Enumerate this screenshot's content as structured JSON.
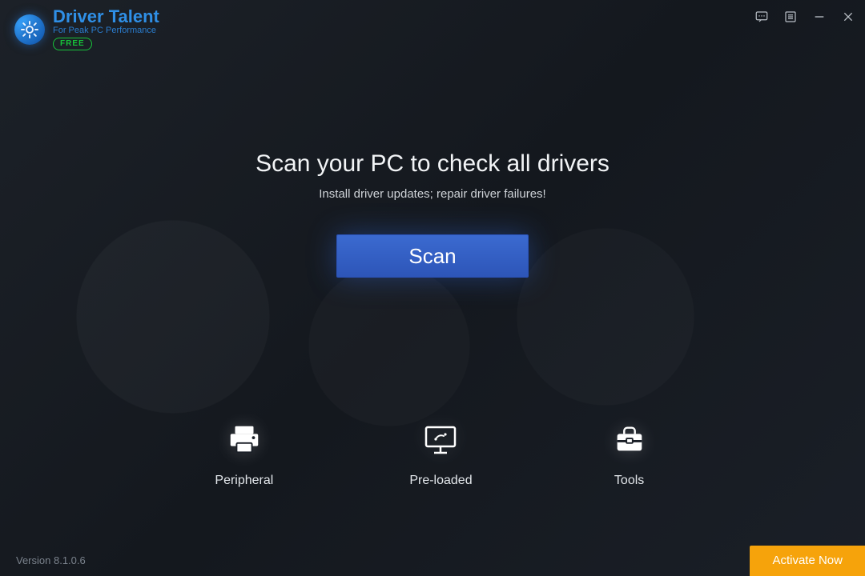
{
  "app": {
    "name_driver": "Driver",
    "name_talent": "Talent",
    "tagline": "For Peak PC Performance",
    "tier_badge": "FREE"
  },
  "main": {
    "headline": "Scan your PC to check all drivers",
    "subline": "Install driver updates; repair driver failures!",
    "scan_label": "Scan"
  },
  "tiles": {
    "peripheral": "Peripheral",
    "preloaded": "Pre-loaded",
    "tools": "Tools"
  },
  "footer": {
    "version": "Version 8.1.0.6",
    "activate_label": "Activate Now"
  }
}
